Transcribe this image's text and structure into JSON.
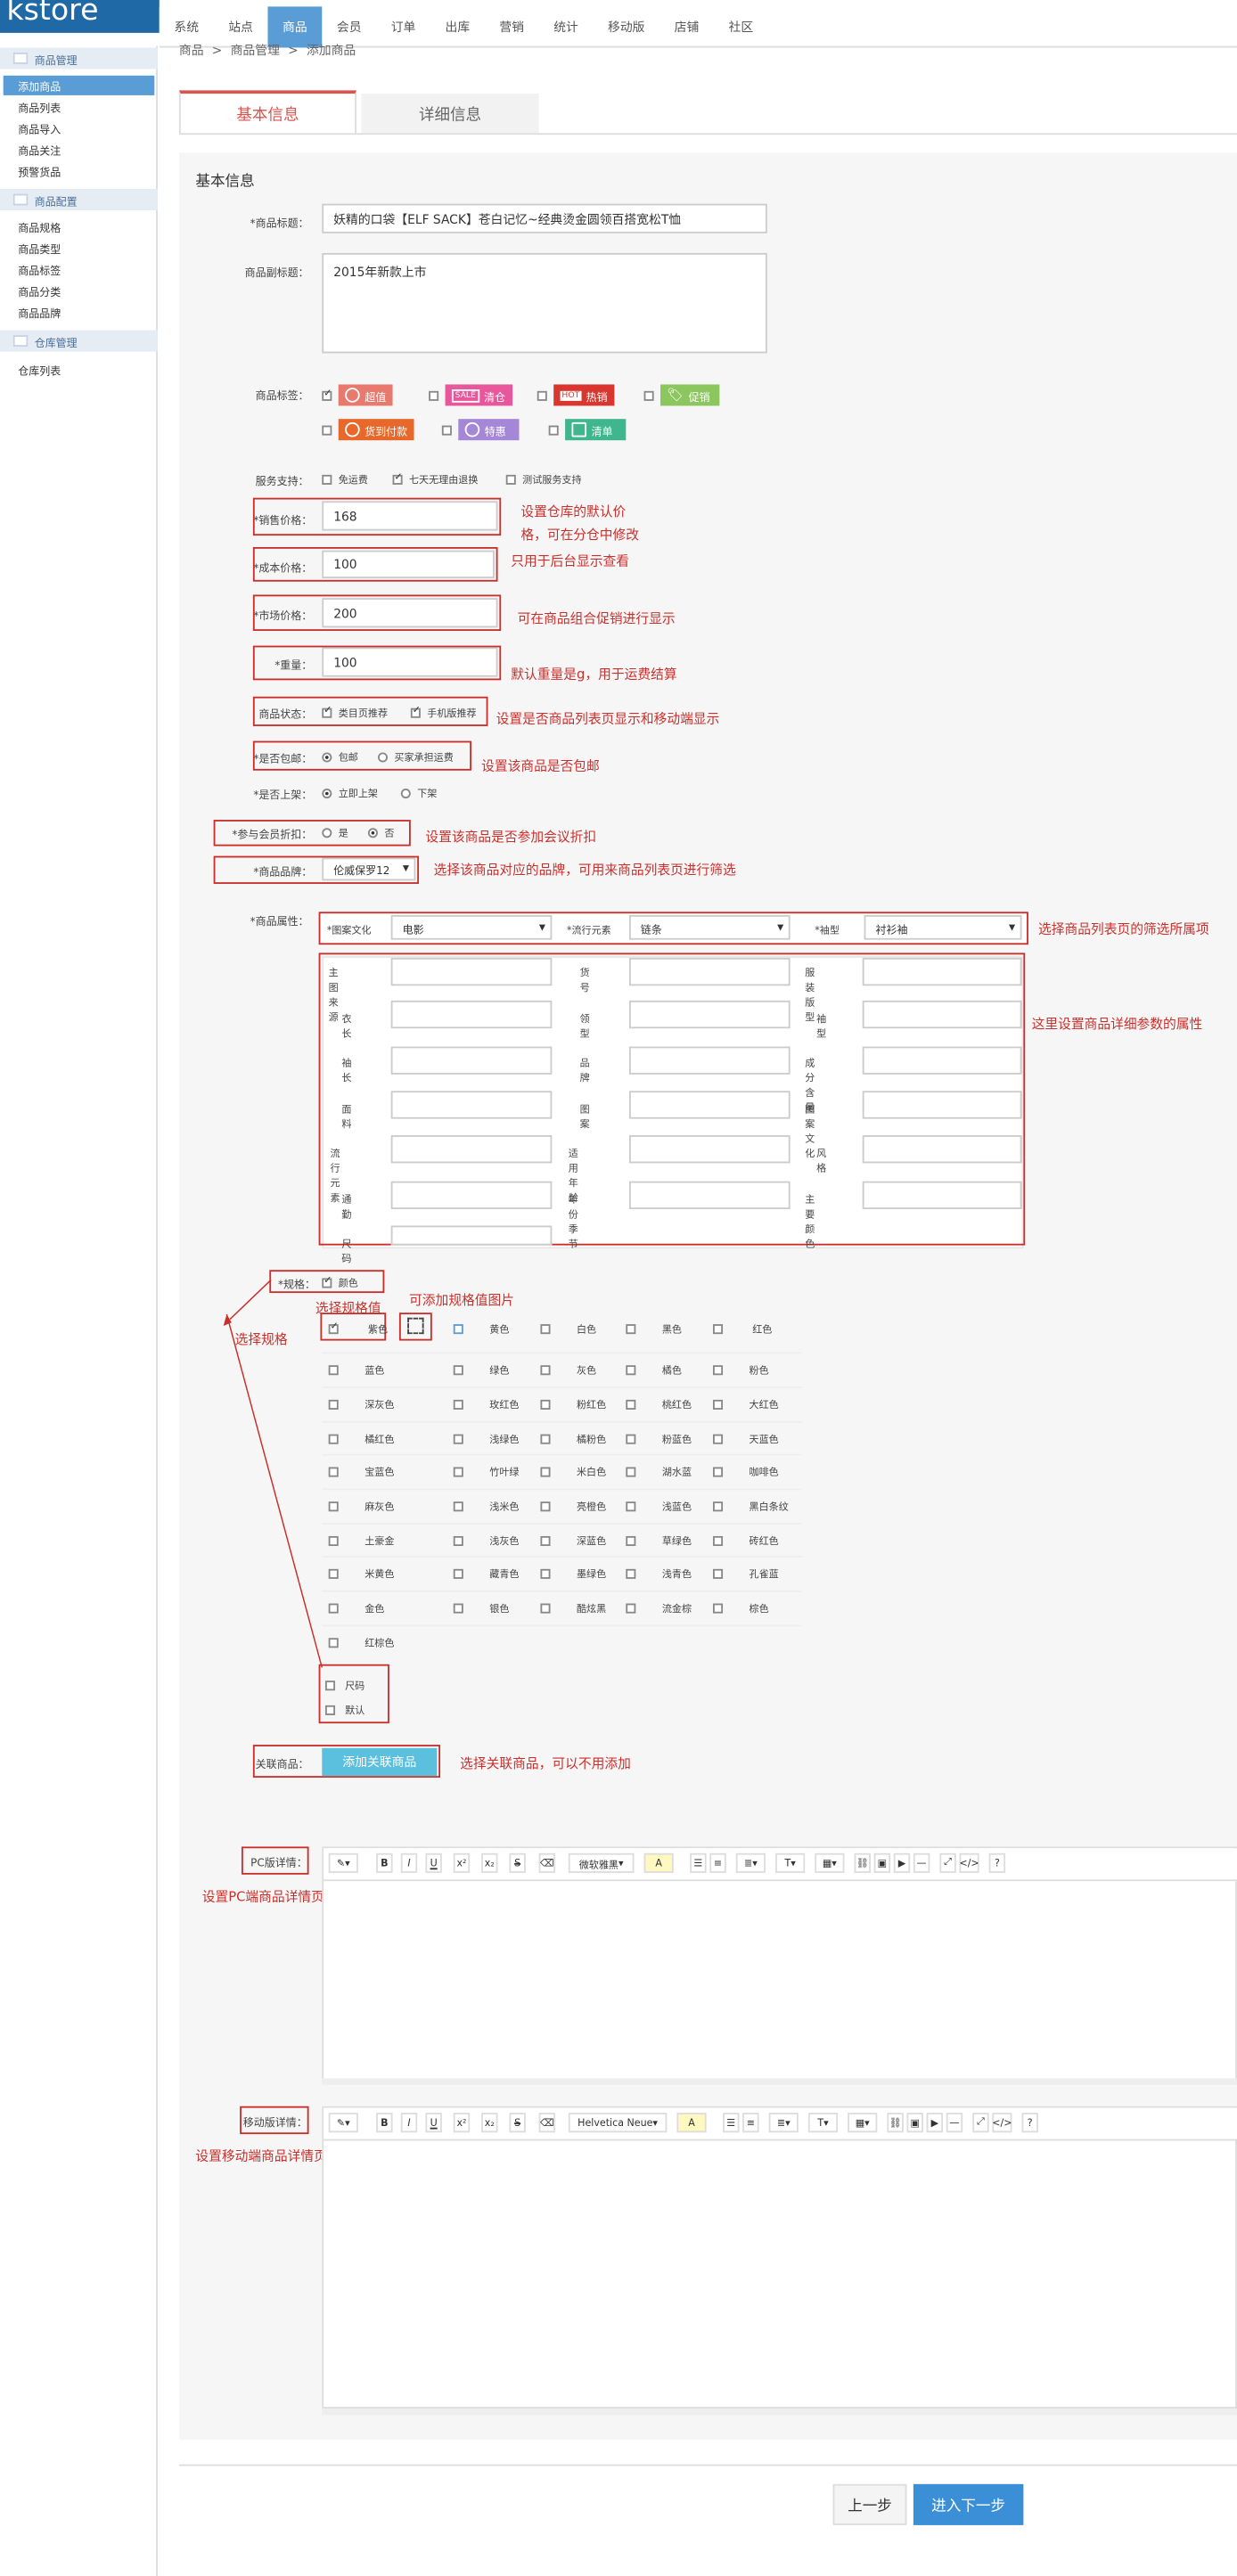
{
  "app": {
    "logo": "kstore"
  },
  "topnav": [
    "系统",
    "站点",
    "商品",
    "会员",
    "订单",
    "出库",
    "营销",
    "统计",
    "移动版",
    "店铺",
    "社区"
  ],
  "sidebar": {
    "groups": [
      {
        "title": "商品管理",
        "items": [
          "添加商品",
          "商品列表",
          "商品导入",
          "商品关注",
          "预警货品"
        ]
      },
      {
        "title": "商品配置",
        "items": [
          "商品规格",
          "商品类型",
          "商品标签",
          "商品分类",
          "商品品牌"
        ]
      },
      {
        "title": "仓库管理",
        "items": [
          "仓库列表"
        ]
      }
    ]
  },
  "breadcrumb": [
    "商品",
    ">",
    "商品管理",
    ">",
    "添加商品"
  ],
  "tabs": [
    "基本信息",
    "详细信息"
  ],
  "section_title": "基本信息",
  "form": {
    "title_label": "*商品标题：",
    "title_value": "妖精的口袋【ELF SACK】苍白记忆~经典烫金圆领百搭宽松T恤",
    "subtitle_label": "商品副标题：",
    "subtitle_value": "2015年新款上市",
    "tags_label": "商品标签：",
    "tags": [
      {
        "label": "超值",
        "color": "#e8796f"
      },
      {
        "label": "清仓",
        "color": "#e8579b"
      },
      {
        "label": "热销",
        "color": "#d9362f"
      },
      {
        "label": "促销",
        "color": "#8cc65e"
      },
      {
        "label": "货到付款",
        "color": "#e8672a"
      },
      {
        "label": "特惠",
        "color": "#a487d6"
      },
      {
        "label": "清单",
        "color": "#3fb68e"
      }
    ],
    "tag_badges": [
      "SALE",
      "HOT"
    ],
    "service_label": "服务支持：",
    "services": [
      "免运费",
      "七天无理由退换",
      "测试服务支持"
    ],
    "sale_price_label": "*销售价格：",
    "sale_price": "168",
    "cost_price_label": "*成本价格：",
    "cost_price": "100",
    "market_price_label": "*市场价格：",
    "market_price": "200",
    "weight_label": "*重量：",
    "weight": "100",
    "status_label": "商品状态：",
    "status_options": [
      "类目页推荐",
      "手机版推荐"
    ],
    "shipping_label": "*是否包邮：",
    "shipping_options": [
      "包邮",
      "买家承担运费"
    ],
    "onsale_label": "*是否上架：",
    "onsale_options": [
      "立即上架",
      "下架"
    ],
    "member_discount_label": "*参与会员折扣：",
    "member_discount_options": [
      "是",
      "否"
    ],
    "brand_label": "*商品品牌：",
    "brand_value": "伦威保罗12",
    "attr_label": "*商品属性：",
    "filter_attrs": [
      {
        "label": "*图案文化",
        "value": "电影"
      },
      {
        "label": "*流行元素",
        "value": "链条"
      },
      {
        "label": "*袖型",
        "value": "衬衫袖"
      }
    ],
    "detail_attrs": [
      [
        "主图来源",
        "货号",
        "服装版型"
      ],
      [
        "衣长",
        "领型",
        "袖型"
      ],
      [
        "袖长",
        "品牌",
        "成分含量"
      ],
      [
        "面料",
        "图案",
        "图案文化"
      ],
      [
        "流行元素",
        "适用年龄",
        "风格"
      ],
      [
        "通勤",
        "年份季节",
        "主要颜色"
      ],
      [
        "尺码"
      ]
    ],
    "spec_label": "*规格：",
    "spec_color": "颜色",
    "colors": [
      [
        "紫色",
        "",
        "黄色",
        "白色",
        "黑色",
        "红色"
      ],
      [
        "蓝色",
        "绿色",
        "灰色",
        "橘色",
        "粉色"
      ],
      [
        "深灰色",
        "玫红色",
        "粉红色",
        "桃红色",
        "大红色"
      ],
      [
        "橘红色",
        "浅绿色",
        "橘粉色",
        "粉蓝色",
        "天蓝色"
      ],
      [
        "宝蓝色",
        "竹叶绿",
        "米白色",
        "湖水蓝",
        "咖啡色"
      ],
      [
        "麻灰色",
        "浅米色",
        "亮橙色",
        "浅蓝色",
        "黑白条纹"
      ],
      [
        "土豪金",
        "浅灰色",
        "深蓝色",
        "草绿色",
        "砖红色"
      ],
      [
        "米黄色",
        "藏青色",
        "墨绿色",
        "浅青色",
        "孔雀蓝"
      ],
      [
        "金色",
        "银色",
        "酷炫黑",
        "流金棕",
        "棕色"
      ],
      [
        "红棕色"
      ]
    ],
    "other_specs": [
      "尺码",
      "默认"
    ],
    "related_label": "关联商品：",
    "related_button": "添加关联商品",
    "pc_detail_label": "PC版详情：",
    "mobile_detail_label": "移动版详情：",
    "pc_font": "微软雅黑",
    "mobile_font": "Helvetica Neue"
  },
  "annotations": {
    "sale_price": "设置仓库的默认价",
    "sale_price_2": "格，可在分仓中修改",
    "cost_price": "只用于后台显示查看",
    "market_price": "可在商品组合促销进行显示",
    "weight": "默认重量是g，用于运费结算",
    "status": "设置是否商品列表页显示和移动端显示",
    "shipping": "设置该商品是否包邮",
    "member_discount": "设置该商品是否参加会议折扣",
    "brand": "选择该商品对应的品牌，可用来商品列表页进行筛选",
    "filter_attrs": "选择商品列表页的筛选所属项",
    "detail_attrs": "这里设置商品详细参数的属性",
    "spec_value": "选择规格值",
    "spec_image": "可添加规格值图片",
    "spec": "选择规格",
    "related": "选择关联商品，可以不用添加",
    "pc_detail": "设置PC端商品详情页的商品详细信息",
    "mobile_detail": "设置移动端商品详情页的商品详细信息"
  },
  "buttons": {
    "prev": "上一步",
    "next": "进入下一步"
  },
  "editor_tools": [
    "B",
    "I",
    "U",
    "x²",
    "x₂",
    "S",
    "A",
    "?"
  ]
}
